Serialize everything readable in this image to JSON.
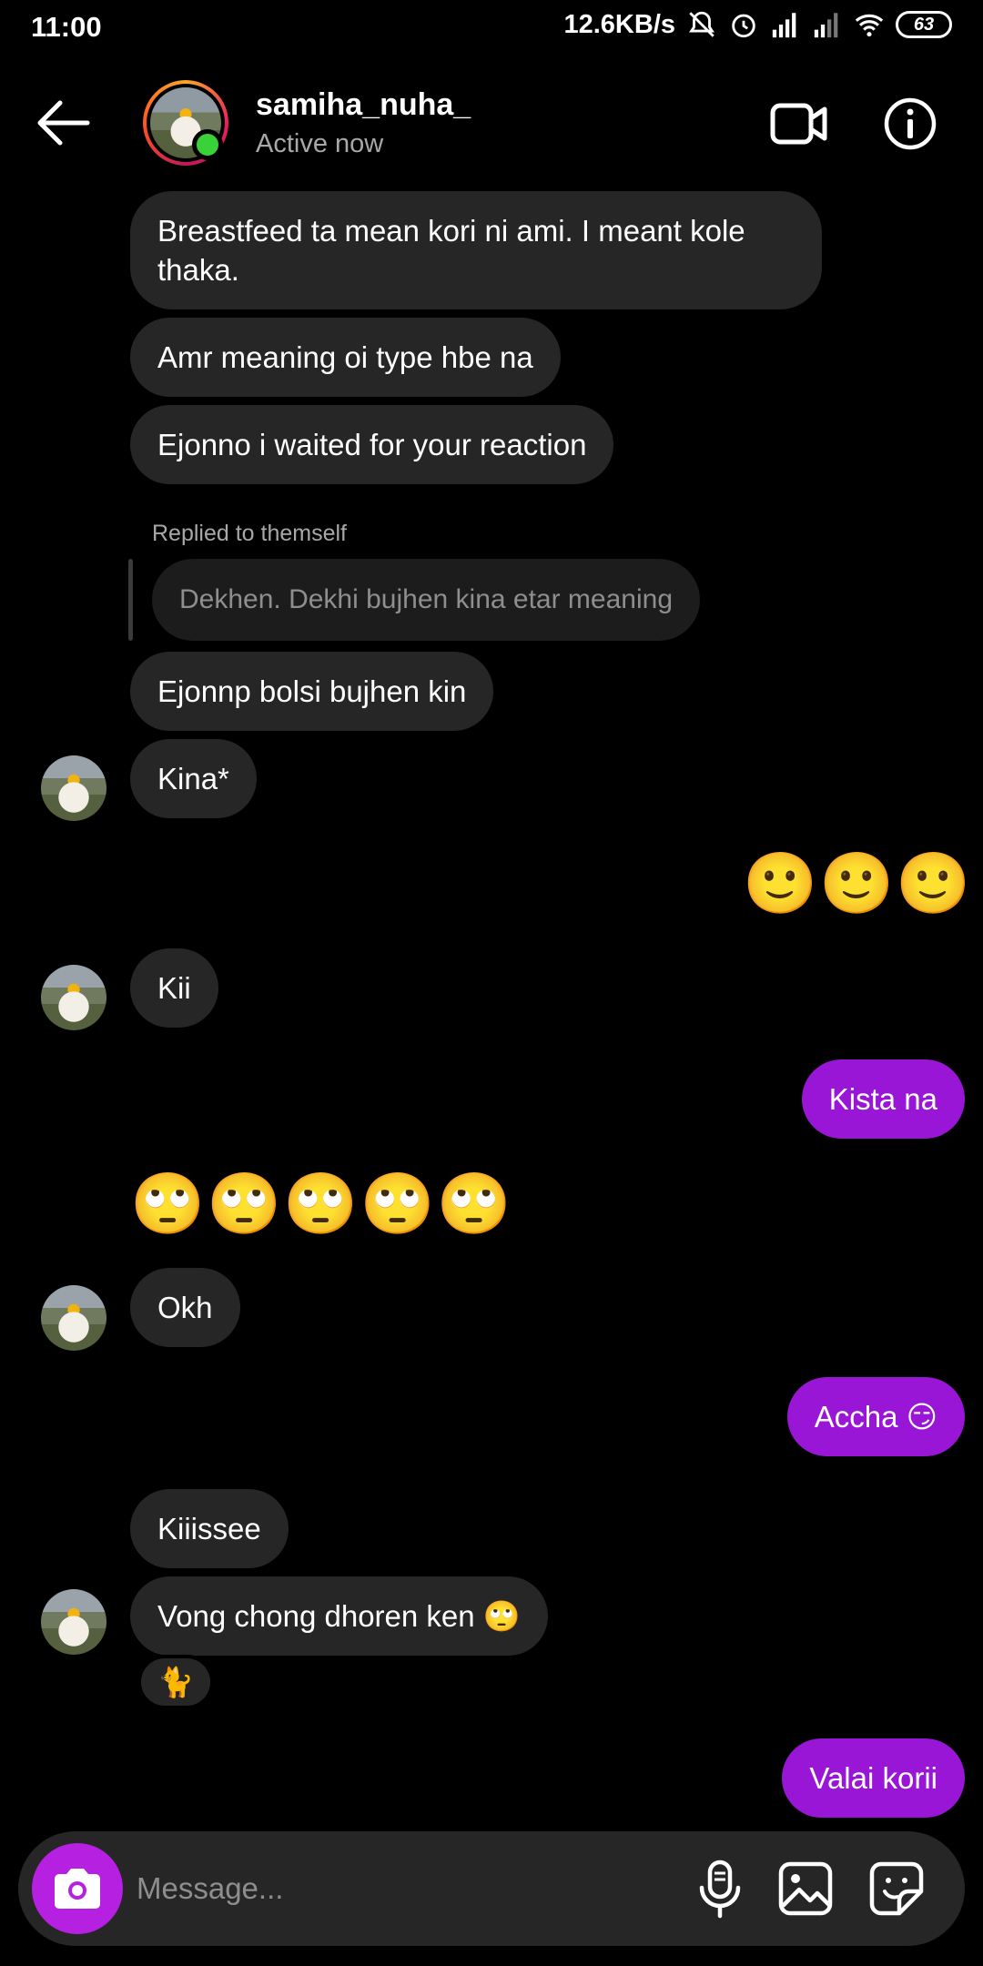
{
  "status_bar": {
    "time": "11:00",
    "network_speed": "12.6KB/s",
    "battery": "63",
    "icons": [
      "mute-bell-icon",
      "alarm-icon",
      "signal-icon",
      "signal-icon",
      "wifi-icon",
      "battery-icon"
    ]
  },
  "header": {
    "username": "samiha_nuha_",
    "status": "Active now",
    "icons": [
      "back-arrow-icon",
      "video-call-icon",
      "info-icon"
    ]
  },
  "messages": [
    {
      "sender": "them",
      "text": "Breastfeed ta mean kori ni ami. I meant kole thaka."
    },
    {
      "sender": "them",
      "text": "Amr meaning oi type hbe na"
    },
    {
      "sender": "them",
      "text": "Ejonno i waited for your reaction"
    },
    {
      "sender": "them",
      "reply_label": "Replied to themself",
      "quoted": "Dekhen. Dekhi bujhen kina etar meaning",
      "text": "Ejonnp bolsi bujhen kin"
    },
    {
      "sender": "them",
      "text": "Kina*"
    },
    {
      "sender": "me",
      "emoji": "🙂🙂🙂"
    },
    {
      "sender": "them",
      "text": "Kii"
    },
    {
      "sender": "me",
      "text": "Kista na"
    },
    {
      "sender": "them",
      "emoji": "🙄🙄🙄🙄🙄"
    },
    {
      "sender": "them",
      "text": "Okh"
    },
    {
      "sender": "me",
      "text": "Accha 😏"
    },
    {
      "sender": "them",
      "text": "Kiiissee"
    },
    {
      "sender": "them",
      "text": "Vong chong dhoren ken 🙄",
      "reaction": "🐈"
    },
    {
      "sender": "me",
      "text": "Valai korii"
    }
  ],
  "composer": {
    "placeholder": "Message...",
    "icons": [
      "camera-icon",
      "microphone-icon",
      "gallery-icon",
      "sticker-icon"
    ]
  },
  "colors": {
    "background": "#000000",
    "their_bubble": "#262626",
    "my_bubble": "#9a16d6",
    "camera_button": "#b620e0",
    "online": "#39d339"
  }
}
